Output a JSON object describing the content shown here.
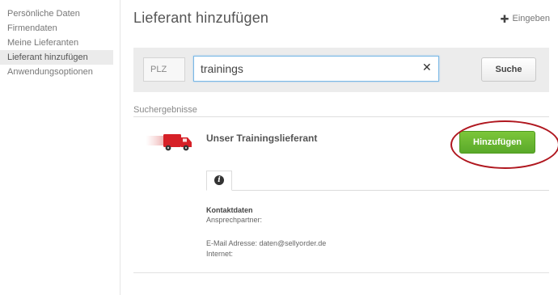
{
  "sidebar": {
    "items": [
      {
        "label": "Persönliche Daten"
      },
      {
        "label": "Firmendaten"
      },
      {
        "label": "Meine Lieferanten"
      },
      {
        "label": "Lieferant hinzufügen"
      },
      {
        "label": "Anwendungsoptionen"
      }
    ]
  },
  "header": {
    "title": "Lieferant hinzufügen",
    "add_icon": "plus-icon",
    "add_label": "Eingeben"
  },
  "search": {
    "plz_label": "PLZ",
    "value": "trainings",
    "clear_icon": "close-icon",
    "button_label": "Suche"
  },
  "results": {
    "heading": "Suchergebnisse",
    "items": [
      {
        "name": "Unser Trainingslieferant",
        "icon": "truck-icon",
        "add_button_label": "Hinzufügen",
        "tab_icon": "info-icon",
        "contact": {
          "title": "Kontaktdaten",
          "person": "Ansprechpartner:",
          "email": "E-Mail Adresse: daten@sellyorder.de",
          "internet": "Internet:"
        }
      }
    ]
  },
  "colors": {
    "accent_green": "#6bb832",
    "highlight_red": "#b0171f",
    "input_focus": "#7ab8e6"
  }
}
